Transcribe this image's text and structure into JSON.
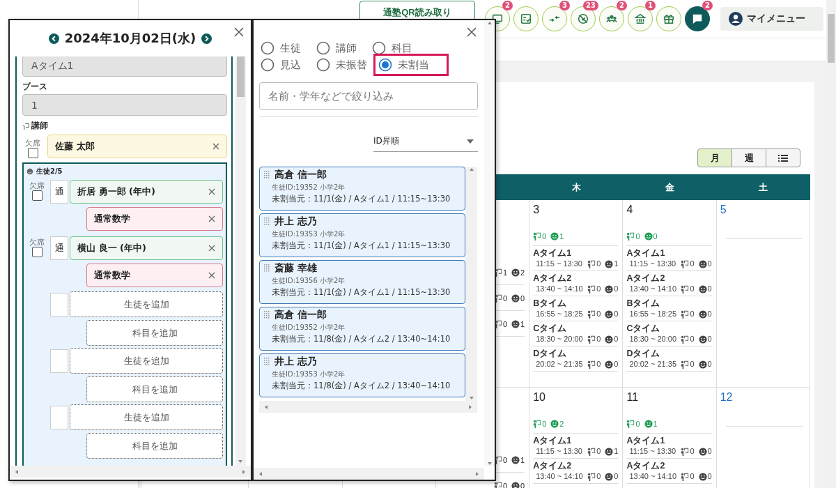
{
  "top_bar": {
    "qr_button": "通塾QR読み取り",
    "icon_buttons": [
      {
        "kind": "monitor",
        "badge": "2"
      },
      {
        "kind": "checklist"
      },
      {
        "kind": "arrows",
        "badge": "3"
      },
      {
        "kind": "crossed",
        "badge": "23"
      },
      {
        "kind": "group",
        "badge": "2"
      },
      {
        "kind": "building",
        "badge": "1"
      },
      {
        "kind": "gift"
      },
      {
        "kind": "chat",
        "badge": "2"
      }
    ],
    "my_menu": "マイメニュー"
  },
  "view_toggle": [
    {
      "kind": "text",
      "label": "月",
      "selected": true
    },
    {
      "kind": "text",
      "label": "週",
      "selected": false
    },
    {
      "kind": "list",
      "selected": false
    }
  ],
  "calendar": {
    "weekdays": [
      "木",
      "金",
      "土"
    ],
    "weeks": [
      {
        "days": [
          {
            "kind": "partial",
            "slots": [
              {
                "teachers": "1",
                "students": "2"
              },
              {
                "teachers": "0",
                "students": "0"
              },
              {
                "teachers": "0",
                "students": "1"
              }
            ]
          },
          {
            "kind": "weekday",
            "date": "3",
            "totals": {
              "teachers": "0",
              "students": "1"
            },
            "slots": [
              {
                "name": "Aタイム1",
                "time": "11:15 ~ 13:30",
                "teachers": "0",
                "students": "1"
              },
              {
                "name": "Aタイム2",
                "time": "13:40 ~ 14:10",
                "teachers": "0",
                "students": "0"
              },
              {
                "name": "Bタイム",
                "time": "16:55 ~ 18:25",
                "teachers": "0",
                "students": "0"
              },
              {
                "name": "Cタイム",
                "time": "18:30 ~ 20:00",
                "teachers": "0",
                "students": "0"
              },
              {
                "name": "Dタイム",
                "time": "20:02 ~ 21:35",
                "teachers": "0",
                "students": "0"
              }
            ]
          },
          {
            "kind": "weekday",
            "date": "4",
            "totals": {
              "teachers": "0",
              "students": "0"
            },
            "slots": [
              {
                "name": "Aタイム1",
                "time": "11:15 ~ 13:30",
                "teachers": "0",
                "students": "0"
              },
              {
                "name": "Aタイム2",
                "time": "13:40 ~ 14:10",
                "teachers": "0",
                "students": "0"
              },
              {
                "name": "Bタイム",
                "time": "16:55 ~ 18:25",
                "teachers": "0",
                "students": "0"
              },
              {
                "name": "Cタイム",
                "time": "18:30 ~ 20:00",
                "teachers": "0",
                "students": "0"
              },
              {
                "name": "Dタイム",
                "time": "20:02 ~ 21:35",
                "teachers": "0",
                "students": "0"
              }
            ]
          },
          {
            "kind": "saturday",
            "date": "5"
          }
        ]
      },
      {
        "days": [
          {
            "kind": "partial",
            "slots": [
              {
                "teachers": "0",
                "students": "1"
              },
              {
                "teachers": "0",
                "students": "0"
              }
            ]
          },
          {
            "kind": "weekday",
            "date": "10",
            "totals": {
              "teachers": "0",
              "students": "2"
            },
            "slots": [
              {
                "name": "Aタイム1",
                "time": "11:15 ~ 13:30",
                "teachers": "0",
                "students": "1"
              },
              {
                "name": "Aタイム2",
                "time": "13:40 ~ 14:10",
                "teachers": "0",
                "students": "0"
              }
            ]
          },
          {
            "kind": "weekday",
            "date": "11",
            "totals": {
              "teachers": "0",
              "students": "1"
            },
            "slots": [
              {
                "name": "Aタイム1",
                "time": "11:15 ~ 13:30",
                "teachers": "0",
                "students": "0"
              },
              {
                "name": "Aタイム2",
                "time": "13:40 ~ 14:10",
                "teachers": "0",
                "students": "0"
              }
            ]
          },
          {
            "kind": "saturday",
            "date": "12"
          }
        ]
      }
    ]
  },
  "lesson_dialog": {
    "date": "2024年10月02日(水)",
    "time_slot": "Aタイム1",
    "booth_label": "ブース",
    "booth": "1",
    "teacher_label": "講師",
    "teacher": {
      "absent_label": "欠席",
      "absent": false,
      "name": "佐藤 太郎"
    },
    "students_label": "生徒2/5",
    "students": [
      {
        "absent_label": "欠席",
        "absent": false,
        "tag": "通",
        "name": "折居 勇一郎 (年中)",
        "subject": "通常数学"
      },
      {
        "absent_label": "欠席",
        "absent": false,
        "tag": "通",
        "name": "横山 良一 (年中)",
        "subject": "通常数学"
      }
    ],
    "empty_slots": [
      {
        "student": "生徒を追加",
        "subject": "科目を追加"
      },
      {
        "student": "生徒を追加",
        "subject": "科目を追加"
      },
      {
        "student": "生徒を追加",
        "subject": "科目を追加"
      }
    ]
  },
  "filter_dialog": {
    "radios": [
      {
        "label": "生徒",
        "selected": false,
        "highlighted": false
      },
      {
        "label": "講師",
        "selected": false,
        "highlighted": false
      },
      {
        "label": "科目",
        "selected": false,
        "highlighted": false
      },
      {
        "label": "見込",
        "selected": false,
        "highlighted": false
      },
      {
        "label": "未振替",
        "selected": false,
        "highlighted": false
      },
      {
        "label": "未割当",
        "selected": true,
        "highlighted": true
      }
    ],
    "placeholder": "名前・学年などで絞り込み",
    "sort": "ID昇順",
    "cards": [
      {
        "name": "高倉 信一郎",
        "meta": "生徒ID:19352 小学2年",
        "detail": "未割当元：11/1(金) / Aタイム1 / 11:15~13:30"
      },
      {
        "name": "井上 志乃",
        "meta": "生徒ID:19353 小学2年",
        "detail": "未割当元：11/1(金) / Aタイム1 / 11:15~13:30"
      },
      {
        "name": "斎藤 幸雄",
        "meta": "生徒ID:19356 小学2年",
        "detail": "未割当元：11/1(金) / Aタイム1 / 11:15~13:30"
      },
      {
        "name": "高倉 信一郎",
        "meta": "生徒ID:19352 小学2年",
        "detail": "未割当元：11/8(金) / Aタイム2 / 13:40~14:10"
      },
      {
        "name": "井上 志乃",
        "meta": "生徒ID:19353 小学2年",
        "detail": "未割当元：11/8(金) / Aタイム2 / 13:40~14:10"
      }
    ]
  }
}
